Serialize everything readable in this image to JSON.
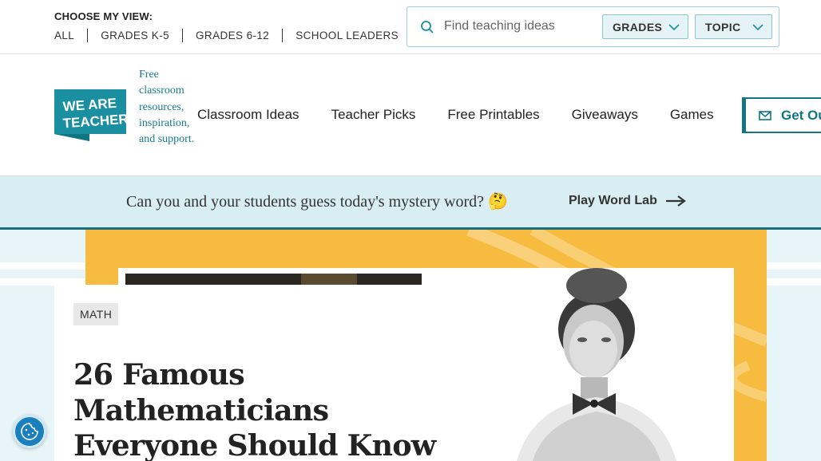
{
  "topbar": {
    "view_label": "CHOOSE MY VIEW:",
    "views": [
      "ALL",
      "GRADES K-5",
      "GRADES 6-12",
      "SCHOOL LEADERS"
    ],
    "search": {
      "placeholder": "Find teaching ideas",
      "value": ""
    },
    "grades_label": "GRADES",
    "topic_label": "TOPIC"
  },
  "header": {
    "logo_text": "WE ARE TEACHERS",
    "tagline": "Free classroom resources, inspiration, and support.",
    "nav": [
      "Classroom Ideas",
      "Teacher Picks",
      "Free Printables",
      "Giveaways",
      "Games"
    ],
    "cta_label": "Get Ou"
  },
  "promo": {
    "text": "Can you and your students guess today's mystery word? 🤔",
    "link_label": "Play Word Lab"
  },
  "hero": {
    "tag": "MATH",
    "headline": "26 Famous Mathematicians Everyone Should Know"
  },
  "colors": {
    "brand_teal": "#1a8fa0",
    "cta_teal": "#127584",
    "promo_bg": "#d9eef2",
    "hero_bg": "#e8f5f8",
    "hero_gold": "#f7bb3f"
  },
  "icons": {
    "search": "search-icon",
    "grades_chevron": "chevron-down-icon",
    "topic_chevron": "chevron-down-icon",
    "cta": "envelope-icon",
    "promo_arrow": "arrow-right-icon",
    "cookie": "cookie-icon"
  }
}
